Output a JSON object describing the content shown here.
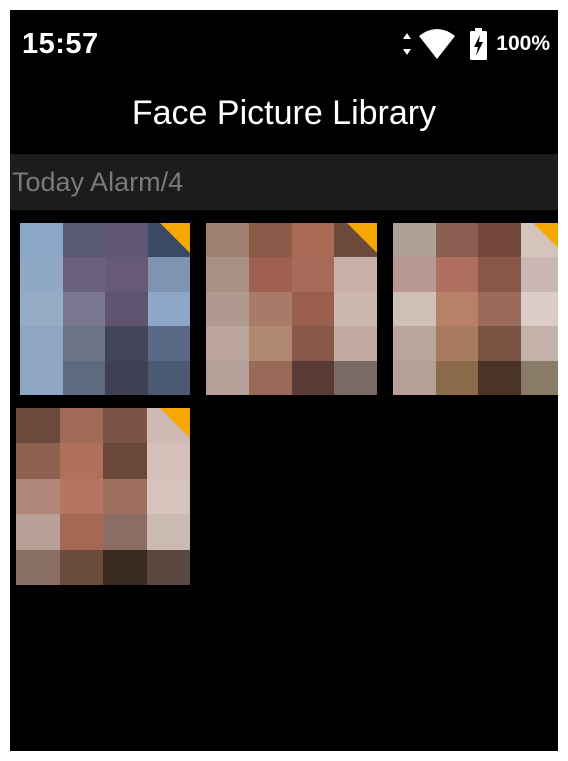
{
  "status_bar": {
    "time": "15:57",
    "battery_percent": "100%",
    "icons": [
      "data-arrows-icon",
      "wifi-icon",
      "battery-charging-icon"
    ]
  },
  "header": {
    "title": "Face Picture Library"
  },
  "section": {
    "label": "Today Alarm/4"
  },
  "colors": {
    "background": "#000000",
    "section_bg": "#1c1c1c",
    "section_text": "#7a7a7a",
    "alarm_flag": "#f7a800"
  },
  "thumbnails": [
    {
      "description_icon": "face-thumbnail",
      "alarm_flag": true,
      "pixels": [
        [
          "#8aa6c8",
          "#5a5a75",
          "#5e5673",
          "#3a4a66"
        ],
        [
          "#8fa8c6",
          "#6a6080",
          "#665a78",
          "#7f94b0"
        ],
        [
          "#96abc4",
          "#7a7890",
          "#5f5570",
          "#8ea6c8"
        ],
        [
          "#8ea6c2",
          "#6c7488",
          "#43465a",
          "#5a6a86"
        ],
        [
          "#8fa6c4",
          "#5f6a80",
          "#3e4154",
          "#4a5a72"
        ]
      ]
    },
    {
      "description_icon": "face-thumbnail",
      "alarm_flag": true,
      "pixels": [
        [
          "#a08070",
          "#8a5a48",
          "#a86a55",
          "#6e4a3e"
        ],
        [
          "#a89085",
          "#a06050",
          "#a86a58",
          "#c8b0a8"
        ],
        [
          "#b09a90",
          "#a87a68",
          "#9a5e4c",
          "#ccb8b0"
        ],
        [
          "#bba49c",
          "#b08870",
          "#8a5848",
          "#c0aaa2"
        ],
        [
          "#b4a098",
          "#9a6a58",
          "#5a3a34",
          "#7a6a64"
        ]
      ]
    },
    {
      "description_icon": "face-thumbnail",
      "alarm_flag": true,
      "pixels": [
        [
          "#b0a098",
          "#8a5e50",
          "#74483e",
          "#d4c4bc"
        ],
        [
          "#b89890",
          "#b07060",
          "#8a5648",
          "#ccb8b2"
        ],
        [
          "#cfc0b8",
          "#b88068",
          "#9a6a5a",
          "#dccdc6"
        ],
        [
          "#b8a59c",
          "#a87a60",
          "#7a5442",
          "#c4b2aa"
        ],
        [
          "#b4a096",
          "#8a6a4a",
          "#4a3426",
          "#8a7a68"
        ]
      ]
    },
    {
      "description_icon": "face-thumbnail",
      "alarm_flag": true,
      "pixels": [
        [
          "#6e4a3e",
          "#a06a58",
          "#7a5446",
          "#cdbab2"
        ],
        [
          "#8e6050",
          "#b0705c",
          "#6a4838",
          "#d4c0b8"
        ],
        [
          "#b08678",
          "#b87462",
          "#a0705e",
          "#d6c4bc"
        ],
        [
          "#b8a096",
          "#a46854",
          "#8a6e64",
          "#cbbab2"
        ],
        [
          "#8a7064",
          "#6a4a38",
          "#3a2a22",
          "#5a4840"
        ]
      ]
    }
  ]
}
